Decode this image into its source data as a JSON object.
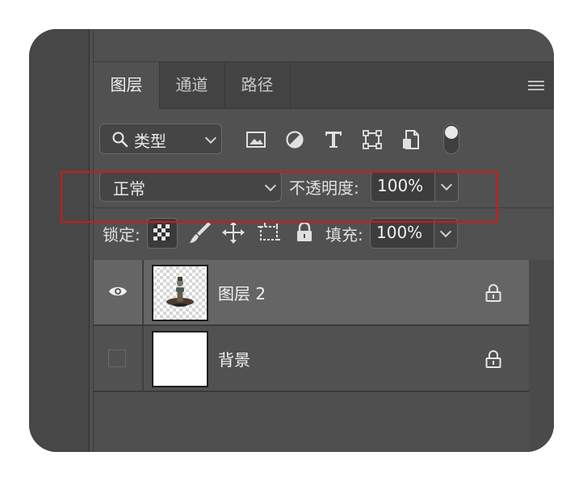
{
  "tabs": [
    {
      "label": "图层",
      "active": true
    },
    {
      "label": "通道",
      "active": false
    },
    {
      "label": "路径",
      "active": false
    }
  ],
  "filter": {
    "kind_label": "类型",
    "icons": [
      "image-filter-icon",
      "adjustment-filter-icon",
      "type-filter-icon",
      "shape-filter-icon",
      "smart-object-filter-icon"
    ]
  },
  "blend": {
    "mode": "正常",
    "opacity_label": "不透明度:",
    "opacity_value": "100%"
  },
  "lock": {
    "label": "锁定:",
    "fill_label": "填充:",
    "fill_value": "100%",
    "highlight_color": "#d01818"
  },
  "layers": [
    {
      "name": "图层 2",
      "visible": true,
      "selected": true,
      "locked": true
    },
    {
      "name": "背景",
      "visible": false,
      "selected": false,
      "locked": true
    }
  ]
}
